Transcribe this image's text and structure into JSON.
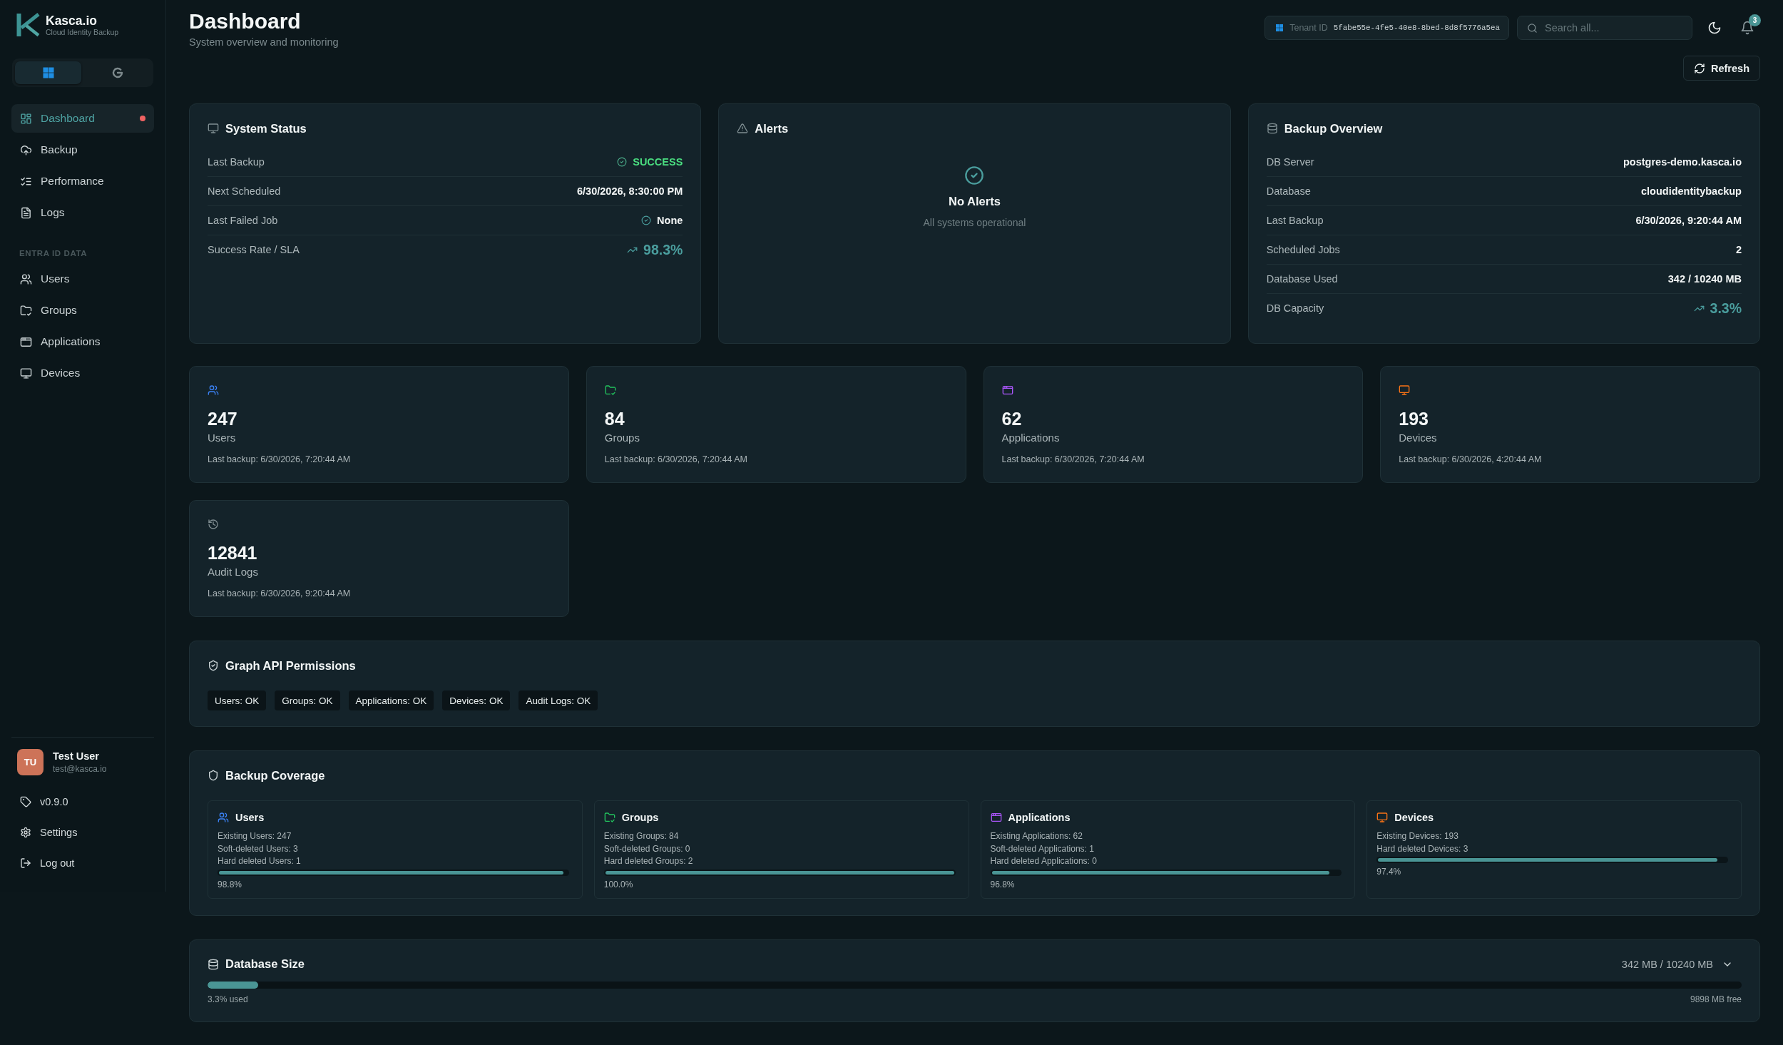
{
  "sidebar": {
    "brand": {
      "name": "Kasca.io",
      "tagline": "Cloud Identity Backup"
    },
    "providers": [
      {
        "kind": "microsoft",
        "selected": true
      },
      {
        "kind": "google",
        "selected": false
      }
    ],
    "nav": [
      {
        "kind": "dashboard",
        "label": "Dashboard",
        "selected": true,
        "alert": true
      },
      {
        "kind": "backup",
        "label": "Backup",
        "selected": false,
        "alert": false
      },
      {
        "kind": "performance",
        "label": "Performance",
        "selected": false,
        "alert": false
      },
      {
        "kind": "logs",
        "label": "Logs",
        "selected": false,
        "alert": false
      }
    ],
    "section": {
      "title": "ENTRA ID DATA",
      "items": [
        {
          "kind": "users",
          "label": "Users",
          "selected": false,
          "alert": false
        },
        {
          "kind": "groups",
          "label": "Groups",
          "selected": false,
          "alert": false
        },
        {
          "kind": "applications",
          "label": "Applications",
          "selected": false,
          "alert": false
        },
        {
          "kind": "devices",
          "label": "Devices",
          "selected": false,
          "alert": false
        }
      ]
    },
    "user": {
      "initials": "TU",
      "name": "Test User",
      "email": "test@kasca.io"
    },
    "links": [
      {
        "kind": "version",
        "label": "v0.9.0"
      },
      {
        "kind": "settings",
        "label": "Settings"
      },
      {
        "kind": "logout",
        "label": "Log out"
      }
    ]
  },
  "header": {
    "title": "Dashboard",
    "subtitle": "System overview and monitoring",
    "tenant": {
      "label": "Tenant ID",
      "value": "5fabe55e-4fe5-40e8-8bed-8d8f5776a5ea"
    },
    "search": {
      "placeholder": "Search all..."
    },
    "notifications": {
      "count": "3"
    },
    "refresh": {
      "label": "Refresh"
    }
  },
  "panels": [
    {
      "kind": "status",
      "title": "System Status",
      "rows": [
        {
          "kind": "status",
          "label": "Last Backup",
          "value": "SUCCESS"
        },
        {
          "kind": "text",
          "label": "Next Scheduled",
          "value": "6/30/2026, 8:30:00 PM"
        },
        {
          "kind": "check",
          "label": "Last Failed Job",
          "value": "None"
        },
        {
          "kind": "metric",
          "label": "Success Rate / SLA",
          "value": "98.3%"
        }
      ]
    },
    {
      "kind": "alerts",
      "title": "Alerts",
      "empty": {
        "title": "No Alerts",
        "text": "All systems operational"
      }
    },
    {
      "kind": "overview",
      "title": "Backup Overview",
      "rows": [
        {
          "kind": "text",
          "label": "DB Server",
          "value": "postgres-demo.kasca.io"
        },
        {
          "kind": "text",
          "label": "Database",
          "value": "cloudidentitybackup"
        },
        {
          "kind": "text",
          "label": "Last Backup",
          "value": "6/30/2026, 9:20:44 AM"
        },
        {
          "kind": "text",
          "label": "Scheduled Jobs",
          "value": "2"
        },
        {
          "kind": "text",
          "label": "Database Used",
          "value": "342 / 10240 MB"
        },
        {
          "kind": "metric",
          "label": "DB Capacity",
          "value": "3.3%"
        }
      ]
    }
  ],
  "stats": [
    {
      "kind": "users",
      "color": "#3b82f6",
      "value": "247",
      "label": "Users",
      "note": "Last backup: 6/30/2026, 7:20:44 AM"
    },
    {
      "kind": "groups",
      "color": "#22c55e",
      "value": "84",
      "label": "Groups",
      "note": "Last backup: 6/30/2026, 7:20:44 AM"
    },
    {
      "kind": "applications",
      "color": "#a855f7",
      "value": "62",
      "label": "Applications",
      "note": "Last backup: 6/30/2026, 7:20:44 AM"
    },
    {
      "kind": "devices",
      "color": "#f97316",
      "value": "193",
      "label": "Devices",
      "note": "Last backup: 6/30/2026, 4:20:44 AM"
    },
    {
      "kind": "audit",
      "color": "#7f8c90",
      "value": "12841",
      "label": "Audit Logs",
      "note": "Last backup: 6/30/2026, 9:20:44 AM"
    }
  ],
  "permissions": {
    "title": "Graph API Permissions",
    "chips": [
      "Users: OK",
      "Groups: OK",
      "Applications: OK",
      "Devices: OK",
      "Audit Logs: OK"
    ]
  },
  "coverage": {
    "title": "Backup Coverage",
    "items": [
      {
        "kind": "users",
        "color": "#3b82f6",
        "title": "Users",
        "lines": [
          "Existing Users: 247",
          "Soft-deleted Users: 3",
          "Hard deleted Users: 1"
        ],
        "level": 0.988,
        "percent": "98.8%"
      },
      {
        "kind": "groups",
        "color": "#22c55e",
        "title": "Groups",
        "lines": [
          "Existing Groups: 84",
          "Soft-deleted Groups: 0",
          "Hard deleted Groups: 2"
        ],
        "level": 1.0,
        "percent": "100.0%"
      },
      {
        "kind": "applications",
        "color": "#a855f7",
        "title": "Applications",
        "lines": [
          "Existing Applications: 62",
          "Soft-deleted Applications: 1",
          "Hard deleted Applications: 0"
        ],
        "level": 0.968,
        "percent": "96.8%"
      },
      {
        "kind": "devices",
        "color": "#f97316",
        "title": "Devices",
        "lines": [
          "Existing Devices: 193",
          "Hard deleted Devices: 3"
        ],
        "level": 0.974,
        "percent": "97.4%"
      }
    ]
  },
  "database": {
    "title": "Database Size",
    "summary": "342 MB / 10240 MB",
    "expanded": false,
    "level": 0.033,
    "used": "3.3% used",
    "free": "9898 MB free"
  }
}
